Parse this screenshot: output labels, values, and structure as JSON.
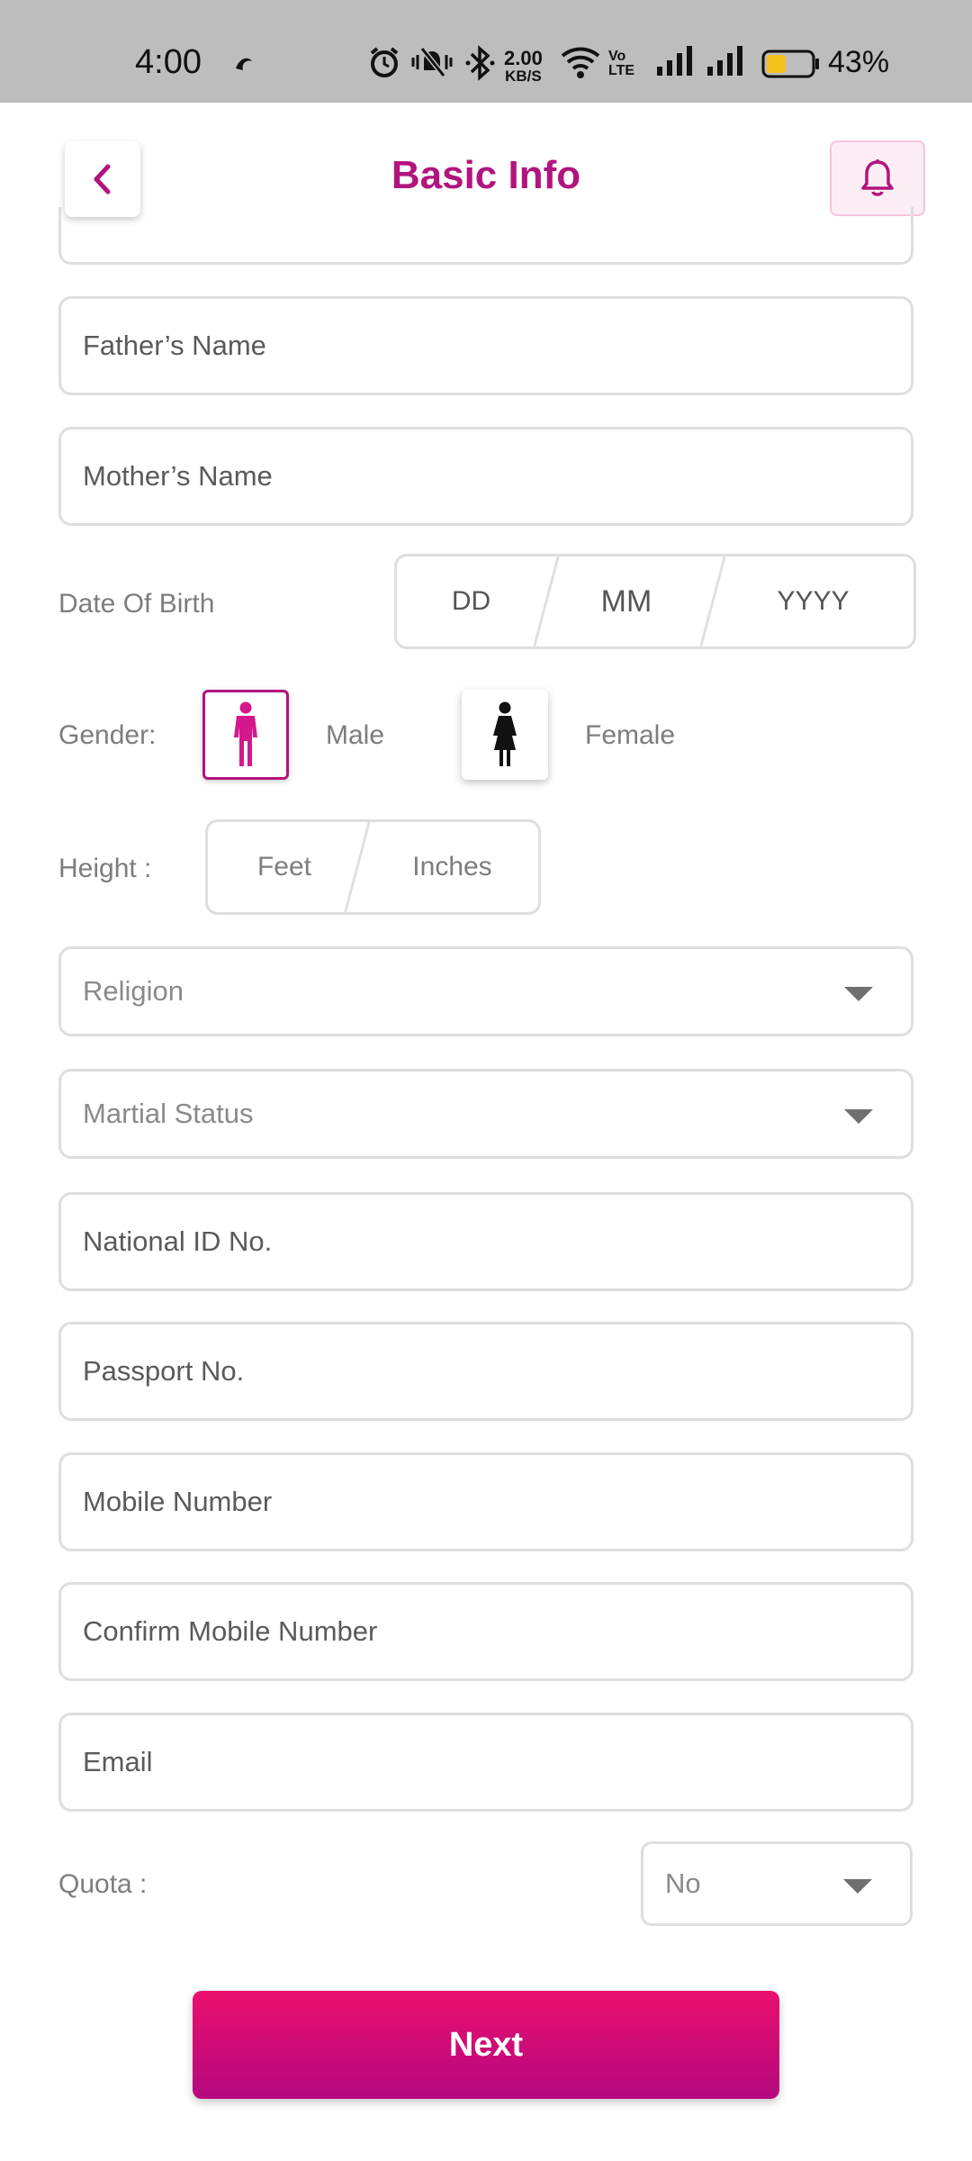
{
  "status_bar": {
    "time": "4:00",
    "net_speed_value": "2.00",
    "net_speed_unit": "KB/S",
    "volte_top": "Vo",
    "volte_bottom": "LTE",
    "battery_percent": "43%",
    "battery_level": 0.43,
    "icons": [
      "snapchat-icon",
      "alarm-icon",
      "mute-vibrate-icon",
      "bluetooth-icon",
      "wifi-icon",
      "signal-icon",
      "signal-icon",
      "battery-icon"
    ]
  },
  "header": {
    "title": "Basic Info",
    "back_icon": "chevron-left-icon",
    "bell_icon": "bell-icon"
  },
  "colors": {
    "brand": "#b1147d",
    "button_gradient_top": "#ea0f6d",
    "button_gradient_bottom": "#b5087f",
    "border": "#dedede",
    "status_bar_bg": "#bdbdbd"
  },
  "form": {
    "fathers_name": {
      "placeholder": "Father’s Name",
      "value": ""
    },
    "mothers_name": {
      "placeholder": "Mother’s Name",
      "value": ""
    },
    "dob": {
      "label": "Date Of Birth",
      "day_placeholder": "DD",
      "month_placeholder": "MM",
      "year_placeholder": "YYYY"
    },
    "gender": {
      "label": "Gender:",
      "male": "Male",
      "female": "Female",
      "selected": "Male"
    },
    "height": {
      "label": "Height :",
      "feet_placeholder": "Feet",
      "inches_placeholder": "Inches"
    },
    "religion": {
      "placeholder": "Religion"
    },
    "marital_status": {
      "placeholder": "Martial Status"
    },
    "national_id": {
      "placeholder": "National ID No.",
      "value": ""
    },
    "passport": {
      "placeholder": "Passport No.",
      "value": ""
    },
    "mobile": {
      "placeholder": "Mobile Number",
      "value": ""
    },
    "confirm_mobile": {
      "placeholder": "Confirm Mobile Number",
      "value": ""
    },
    "email": {
      "placeholder": "Email",
      "value": ""
    },
    "quota": {
      "label": "Quota :",
      "value": "No"
    }
  },
  "actions": {
    "next_label": "Next"
  }
}
